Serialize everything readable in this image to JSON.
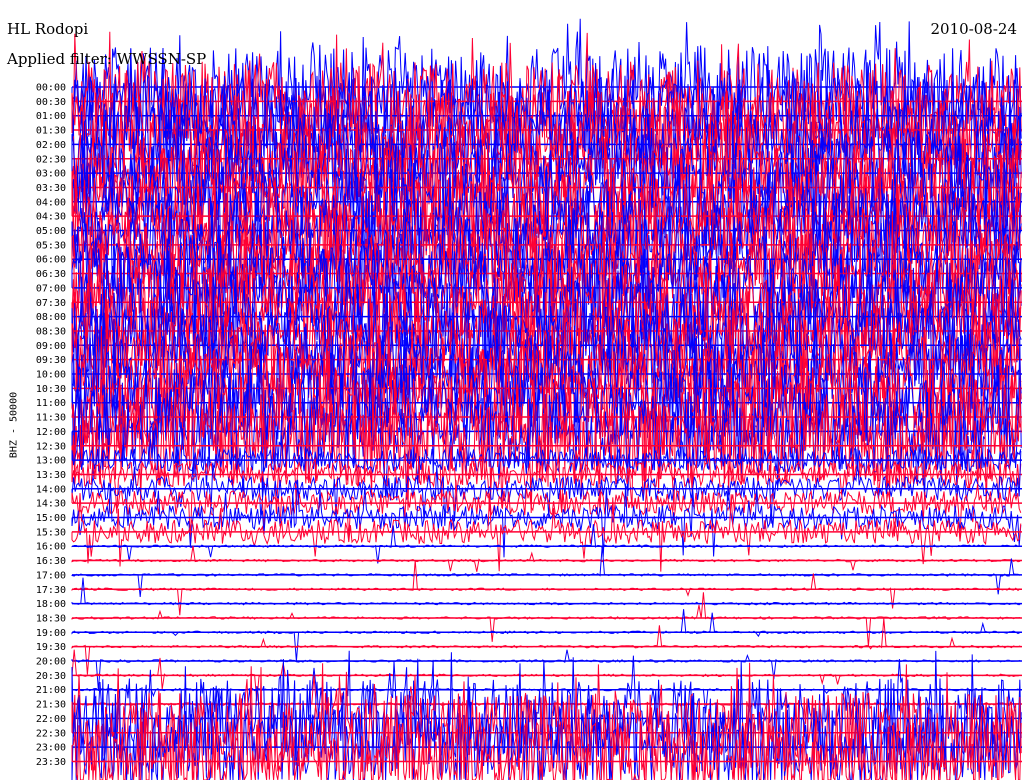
{
  "header": {
    "station": "HL Rodopi",
    "date": "2010-08-24",
    "filter": "Applied filter: WWSSN-SP"
  },
  "colors": {
    "trace_a": "#ff0033",
    "trace_b": "#0000ff",
    "background": "#ffffff"
  },
  "chart_data": {
    "type": "line",
    "title": "HL Rodopi",
    "subtitle": "Applied filter: WWSSN-SP",
    "ylabel": "BHZ - 50000",
    "xlabel": "",
    "grid": false,
    "ticks": [
      "00:00",
      "00:30",
      "01:00",
      "01:30",
      "02:00",
      "02:30",
      "03:00",
      "03:30",
      "04:00",
      "04:30",
      "05:00",
      "05:30",
      "06:00",
      "06:30",
      "07:00",
      "07:30",
      "08:00",
      "08:30",
      "09:00",
      "09:30",
      "10:00",
      "10:30",
      "11:00",
      "11:30",
      "12:00",
      "12:30",
      "13:00",
      "13:30",
      "14:00",
      "14:30",
      "15:00",
      "15:30",
      "16:00",
      "16:30",
      "17:00",
      "17:30",
      "18:00",
      "18:30",
      "19:00",
      "19:30",
      "20:00",
      "20:30",
      "21:00",
      "21:30",
      "22:00",
      "22:30",
      "23:00",
      "23:30"
    ],
    "row_color_sequence": [
      "trace_b",
      "trace_a"
    ],
    "activity_profile": [
      {
        "from": "00:00",
        "to": "12:30",
        "level": "saturated"
      },
      {
        "from": "13:00",
        "to": "15:30",
        "level": "dense"
      },
      {
        "from": "16:00",
        "to": "21:30",
        "level": "quiet"
      },
      {
        "from": "22:00",
        "to": "23:30",
        "level": "saturated"
      }
    ]
  }
}
